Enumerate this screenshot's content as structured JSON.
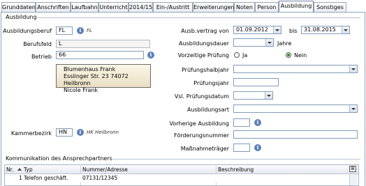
{
  "tabs": [
    {
      "label": "Grunddaten",
      "active": false
    },
    {
      "label": "Anschriften",
      "active": false
    },
    {
      "label": "Laufbahn",
      "active": false
    },
    {
      "label": "Unterricht",
      "active": false
    },
    {
      "label": "2014/15",
      "active": false
    },
    {
      "label": "Ein-/Austritt",
      "active": false
    },
    {
      "label": "Erweiterungen",
      "active": false
    },
    {
      "label": "Noten",
      "active": false
    },
    {
      "label": "Person",
      "active": false
    },
    {
      "label": "Ausbildung",
      "active": true
    },
    {
      "label": "Sonstiges",
      "active": false
    }
  ],
  "ausbildung": {
    "group_title": "Ausbildung",
    "beruf_label": "Ausbildungsberuf",
    "beruf_value": "FL",
    "beruf_hint": "FL",
    "berufsfeld_label": "Berufsfeld",
    "berufsfeld_value": "L",
    "betrieb_label": "Betrieb",
    "betrieb_value": "66",
    "address_lines": [
      "Blumenhaus Frank",
      "Esslinger Str. 23 74072 Heilbronn",
      "Nicole Frank"
    ],
    "kammer_label": "Kammerbezirk",
    "kammer_value": "HN",
    "kammer_hint": "HK Heilbronn",
    "vertrag_label": "Ausb.vertrag von",
    "vertrag_von": "01.09.2012",
    "bis_label": "bis",
    "vertrag_bis": "31.08.2015",
    "dauer_label": "Ausbildungsdauer",
    "dauer_value": "",
    "jahre_label": "Jahre",
    "pruefung_label": "Vorzeitige Prüfung",
    "ja_label": "Ja",
    "nein_label": "Nein",
    "pruefung_selected": "Nein",
    "halbjahr_label": "Prüfungshalbjahr",
    "pruefungsjahr_label": "Prüfungsjahr",
    "vsl_label": "Vsl. Prüfungsdatum",
    "art_label": "Ausbildungsart",
    "vorherige_label": "Vorherige Ausbildung",
    "foerder_label": "Förderungsnummer",
    "massnahme_label": "Maßnahmeträger"
  },
  "kommunikation": {
    "group_title": "Kommunikation des Ansprechpartners",
    "columns": [
      "Nr.",
      "Typ",
      "Nummer/Adresse",
      "Beschreibung"
    ],
    "rows": [
      {
        "nr": "1",
        "typ": "Telefon geschäft.",
        "nummer": "07131/12345",
        "beschreibung": ""
      }
    ]
  },
  "colors": {
    "accent": "#5b7fb8",
    "tab_border": "#9aa7b8"
  }
}
